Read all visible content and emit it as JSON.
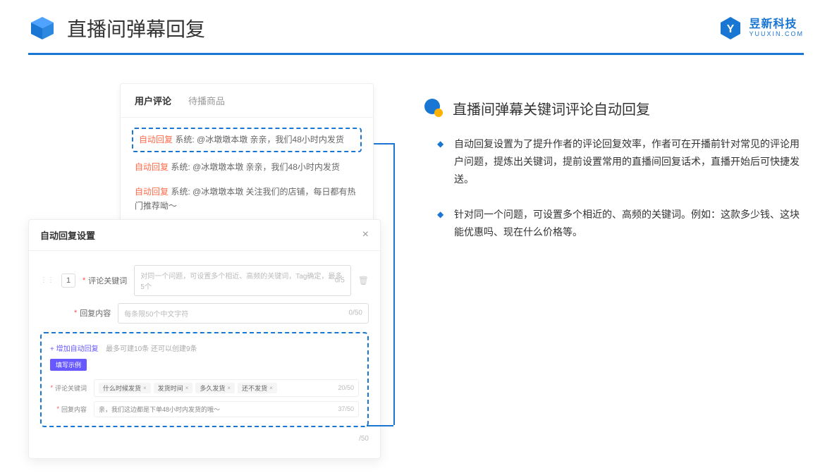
{
  "header": {
    "title": "直播间弹幕回复",
    "brand_name": "昱新科技",
    "brand_url": "YUUXIN.COM"
  },
  "comments": {
    "tabs": {
      "user_comments": "用户评论",
      "pending_goods": "待播商品"
    },
    "items": [
      {
        "tag": "自动回复",
        "text": "系统: @冰墩墩本墩 亲亲，我们48小时内发货"
      },
      {
        "tag": "自动回复",
        "text": "系统: @冰墩墩本墩 亲亲，我们48小时内发货"
      },
      {
        "tag": "自动回复",
        "text": "系统: @冰墩墩本墩 关注我们的店铺，每日都有热门推荐呦～"
      }
    ]
  },
  "settings": {
    "title": "自动回复设置",
    "row_num": "1",
    "keyword_label": "评论关键词",
    "keyword_placeholder": "对同一个问题，可设置多个相近、高频的关键词，Tag确定，最多5个",
    "keyword_count": "0/5",
    "content_label": "回复内容",
    "content_placeholder": "每条限50个中文字符",
    "content_count": "0/50",
    "add_link": "+ 增加自动回复",
    "add_hint": "最多可建10条 还可以创建9条",
    "example_badge": "填写示例",
    "ex_keyword_label": "评论关键词",
    "ex_tags": [
      "什么时候发货",
      "发货时间",
      "多久发货",
      "还不发货"
    ],
    "ex_keyword_count": "20/50",
    "ex_content_label": "回复内容",
    "ex_content_text": "亲，我们这边都是下单48小时内发货的哦～",
    "ex_content_count": "37/50",
    "outer_count": "/50"
  },
  "section": {
    "title": "直播间弹幕关键词评论自动回复",
    "bullets": [
      "自动回复设置为了提升作者的评论回复效率，作者可在开播前针对常见的评论用户问题，提炼出关键词，提前设置常用的直播间回复话术，直播开始后可快捷发送。",
      "针对同一个问题，可设置多个相近的、高频的关键词。例如：这款多少钱、这块能优惠吗、现在什么价格等。"
    ]
  }
}
